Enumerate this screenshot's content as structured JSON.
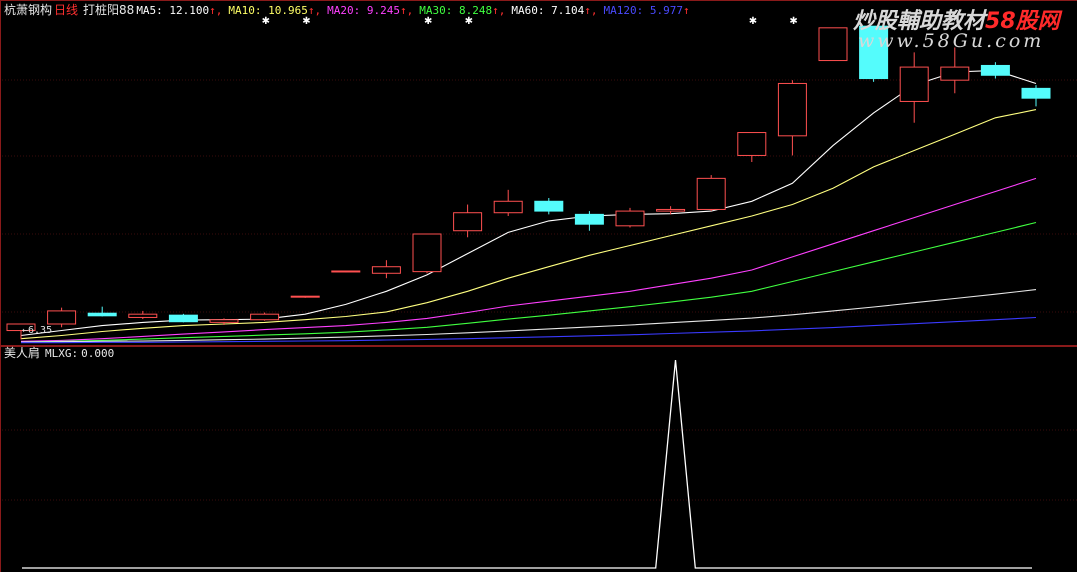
{
  "header": {
    "stock_name": "杭萧钢构",
    "period": "日线",
    "indicator_name": "打桩阳88",
    "ma_readouts": [
      {
        "label": "MA5:",
        "value": "12.100",
        "arrow": "↑",
        "color": "#ffffff"
      },
      {
        "label": "MA10:",
        "value": "10.965",
        "arrow": "↑",
        "color": "#ffff66"
      },
      {
        "label": "MA20:",
        "value": "9.245",
        "arrow": "↑",
        "color": "#ff40ff"
      },
      {
        "label": "MA30:",
        "value": "8.248",
        "arrow": "↑",
        "color": "#40ff40"
      },
      {
        "label": "MA60:",
        "value": "7.104",
        "arrow": "↑",
        "color": "#ffffff"
      },
      {
        "label": "MA120:",
        "value": "5.977",
        "arrow": "↑",
        "color": "#4a4aff"
      }
    ],
    "arrow_color": "#ff3030"
  },
  "watermark": {
    "line1_main": "炒股輔助教材",
    "line1_red": "58股网",
    "line2": "www.58Gu.com"
  },
  "lower_pane": {
    "indicator_name": "美人肩",
    "readout_label": "MLXG:",
    "readout_value": "0.000"
  },
  "chart_data": [
    {
      "type": "candlestick",
      "title": "",
      "price_range": [
        6.2,
        16.1
      ],
      "up_color": "#ff5050",
      "down_color": "#54fcfc",
      "min_price_annotation": "6.35",
      "candles": [
        {
          "o": 6.55,
          "h": 6.72,
          "l": 6.28,
          "c": 6.75
        },
        {
          "o": 6.75,
          "h": 7.25,
          "l": 6.65,
          "c": 7.15
        },
        {
          "o": 7.08,
          "h": 7.28,
          "l": 6.98,
          "c": 7.0
        },
        {
          "o": 6.95,
          "h": 7.15,
          "l": 6.9,
          "c": 7.05
        },
        {
          "o": 7.02,
          "h": 7.06,
          "l": 6.8,
          "c": 6.82
        },
        {
          "o": 6.8,
          "h": 6.92,
          "l": 6.72,
          "c": 6.88
        },
        {
          "o": 6.88,
          "h": 7.1,
          "l": 6.85,
          "c": 7.05
        },
        {
          "o": 7.58,
          "h": 7.6,
          "l": 7.55,
          "c": 7.6
        },
        {
          "o": 8.35,
          "h": 8.37,
          "l": 8.33,
          "c": 8.37
        },
        {
          "o": 8.3,
          "h": 8.7,
          "l": 8.15,
          "c": 8.5
        },
        {
          "o": 8.35,
          "h": 9.5,
          "l": 8.3,
          "c": 9.5
        },
        {
          "o": 9.6,
          "h": 10.4,
          "l": 9.4,
          "c": 10.15
        },
        {
          "o": 10.15,
          "h": 10.85,
          "l": 10.05,
          "c": 10.5
        },
        {
          "o": 10.5,
          "h": 10.6,
          "l": 10.1,
          "c": 10.2
        },
        {
          "o": 10.1,
          "h": 10.2,
          "l": 9.6,
          "c": 9.8
        },
        {
          "o": 9.75,
          "h": 10.3,
          "l": 9.7,
          "c": 10.2
        },
        {
          "o": 10.2,
          "h": 10.35,
          "l": 10.1,
          "c": 10.25
        },
        {
          "o": 10.25,
          "h": 11.3,
          "l": 10.2,
          "c": 11.2
        },
        {
          "o": 11.9,
          "h": 12.6,
          "l": 11.7,
          "c": 12.6
        },
        {
          "o": 12.5,
          "h": 14.2,
          "l": 11.9,
          "c": 14.1
        },
        {
          "o": 14.8,
          "h": 15.8,
          "l": 14.8,
          "c": 15.8
        },
        {
          "o": 15.85,
          "h": 15.85,
          "l": 14.15,
          "c": 14.25
        },
        {
          "o": 13.55,
          "h": 15.05,
          "l": 12.9,
          "c": 14.6
        },
        {
          "o": 14.2,
          "h": 15.2,
          "l": 13.8,
          "c": 14.6
        },
        {
          "o": 14.65,
          "h": 14.75,
          "l": 14.25,
          "c": 14.35
        },
        {
          "o": 13.95,
          "h": 14.05,
          "l": 13.4,
          "c": 13.65
        }
      ],
      "signal_markers": [
        6,
        7,
        10,
        11,
        18,
        19
      ],
      "moving_averages": [
        {
          "name": "MA5",
          "color": "#ffffff",
          "values": [
            6.4,
            6.55,
            6.7,
            6.8,
            6.87,
            6.88,
            6.9,
            7.05,
            7.35,
            7.75,
            8.25,
            8.9,
            9.55,
            9.9,
            10.05,
            10.1,
            10.12,
            10.2,
            10.5,
            11.05,
            12.2,
            13.2,
            14.05,
            14.45,
            14.5,
            14.1
          ]
        },
        {
          "name": "MA10",
          "color": "#ffff80",
          "values": [
            6.3,
            6.4,
            6.52,
            6.62,
            6.7,
            6.75,
            6.8,
            6.88,
            6.98,
            7.12,
            7.4,
            7.75,
            8.15,
            8.5,
            8.85,
            9.15,
            9.45,
            9.75,
            10.05,
            10.4,
            10.9,
            11.55,
            12.05,
            12.55,
            13.05,
            13.3
          ]
        },
        {
          "name": "MA20",
          "color": "#ff40ff",
          "values": [
            6.22,
            6.25,
            6.3,
            6.37,
            6.44,
            6.51,
            6.58,
            6.64,
            6.7,
            6.8,
            6.92,
            7.1,
            7.3,
            7.45,
            7.6,
            7.75,
            7.95,
            8.15,
            8.4,
            8.8,
            9.2,
            9.6,
            10.0,
            10.4,
            10.8,
            11.2
          ]
        },
        {
          "name": "MA30",
          "color": "#40ff40",
          "values": [
            6.2,
            6.22,
            6.25,
            6.29,
            6.33,
            6.37,
            6.41,
            6.45,
            6.5,
            6.57,
            6.65,
            6.77,
            6.9,
            7.02,
            7.15,
            7.28,
            7.42,
            7.57,
            7.75,
            8.05,
            8.35,
            8.65,
            8.95,
            9.25,
            9.55,
            9.85
          ]
        },
        {
          "name": "MA60",
          "color": "#e6e6e6",
          "values": [
            6.2,
            6.21,
            6.22,
            6.23,
            6.25,
            6.27,
            6.29,
            6.32,
            6.35,
            6.39,
            6.43,
            6.48,
            6.54,
            6.6,
            6.66,
            6.72,
            6.79,
            6.86,
            6.93,
            7.03,
            7.15,
            7.27,
            7.4,
            7.53,
            7.66,
            7.8
          ]
        },
        {
          "name": "MA120",
          "color": "#3a3aff",
          "values": [
            6.18,
            6.18,
            6.19,
            6.19,
            6.2,
            6.21,
            6.22,
            6.23,
            6.24,
            6.26,
            6.28,
            6.3,
            6.33,
            6.36,
            6.39,
            6.42,
            6.46,
            6.5,
            6.54,
            6.59,
            6.64,
            6.7,
            6.76,
            6.82,
            6.88,
            6.95
          ]
        }
      ]
    },
    {
      "type": "line",
      "title": "",
      "series": [
        {
          "values": [
            0,
            0,
            0,
            0,
            0,
            0,
            0,
            0,
            0,
            0,
            0,
            0,
            0,
            0,
            0,
            0,
            0,
            0,
            0,
            0,
            0,
            0,
            0,
            0,
            0,
            0,
            0,
            0,
            0,
            0,
            0,
            0,
            0,
            1,
            0,
            0,
            0,
            0,
            0,
            0,
            0,
            0,
            0,
            0,
            0,
            0,
            0,
            0,
            0,
            0,
            0,
            0
          ]
        }
      ],
      "ylim": [
        0,
        1
      ],
      "line_color": "#ffffff"
    }
  ]
}
